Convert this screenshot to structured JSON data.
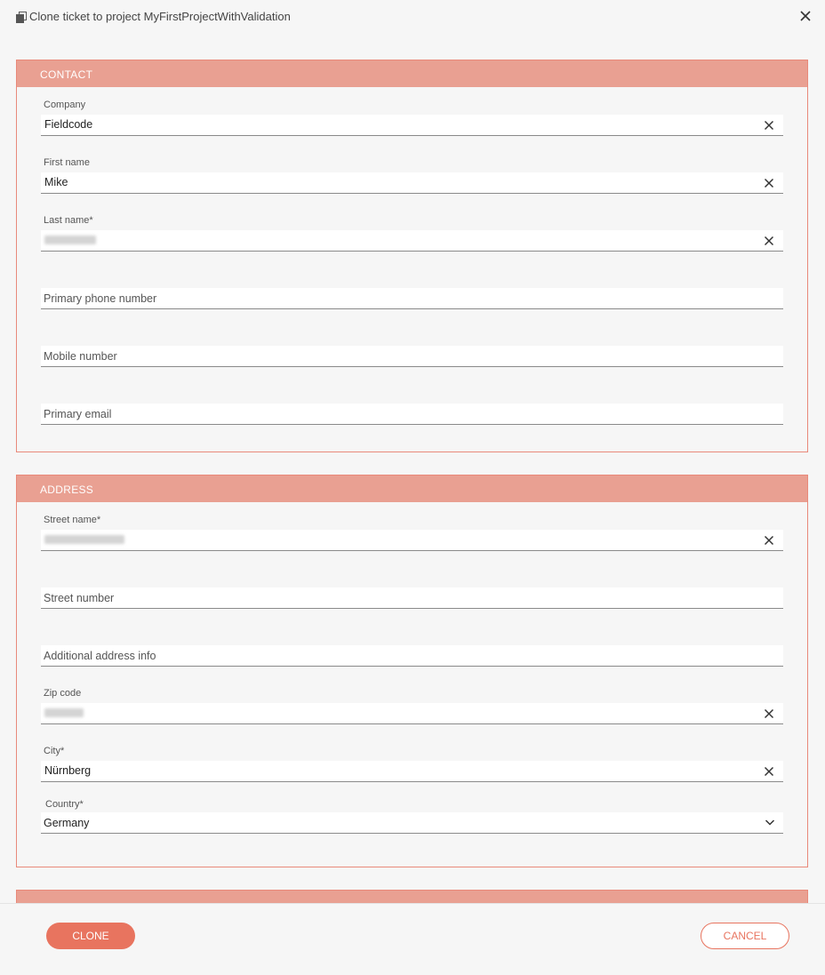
{
  "dialog": {
    "title": "Clone ticket to project MyFirstProjectWithValidation"
  },
  "contact": {
    "header": "CONTACT",
    "company_label": "Company",
    "company_value": "Fieldcode",
    "first_name_label": "First name",
    "first_name_value": "Mike",
    "last_name_label": "Last name*",
    "primary_phone_placeholder": "Primary phone number",
    "mobile_placeholder": "Mobile number",
    "primary_email_placeholder": "Primary email"
  },
  "address": {
    "header": "ADDRESS",
    "street_name_label": "Street name*",
    "street_number_placeholder": "Street number",
    "additional_info_placeholder": "Additional address info",
    "zip_label": "Zip code",
    "city_label": "City*",
    "city_value": "Nürnberg",
    "country_label": "Country*",
    "country_value": "Germany"
  },
  "footer": {
    "clone_label": "CLONE",
    "cancel_label": "CANCEL"
  },
  "colors": {
    "accent": "#e8745f",
    "section_header": "#e9a092",
    "section_border": "#e9897a"
  }
}
